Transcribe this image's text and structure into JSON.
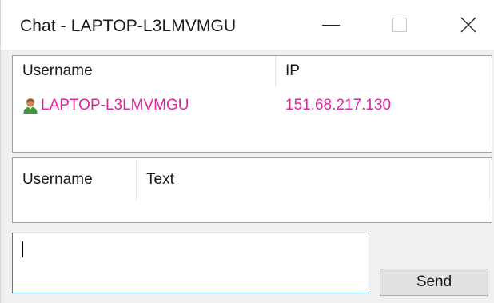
{
  "window": {
    "title": "Chat - LAPTOP-L3LMVMGU",
    "controls": [
      "minimize",
      "maximize",
      "close"
    ]
  },
  "users_list": {
    "columns": [
      "Username",
      "IP"
    ],
    "rows": [
      {
        "username": "LAPTOP-L3LMVMGU",
        "ip": "151.68.217.130",
        "icon": "user-icon",
        "color": "#e0259b"
      }
    ]
  },
  "messages_list": {
    "columns": [
      "Username",
      "Text"
    ],
    "rows": []
  },
  "composer": {
    "value": "",
    "send_label": "Send"
  }
}
